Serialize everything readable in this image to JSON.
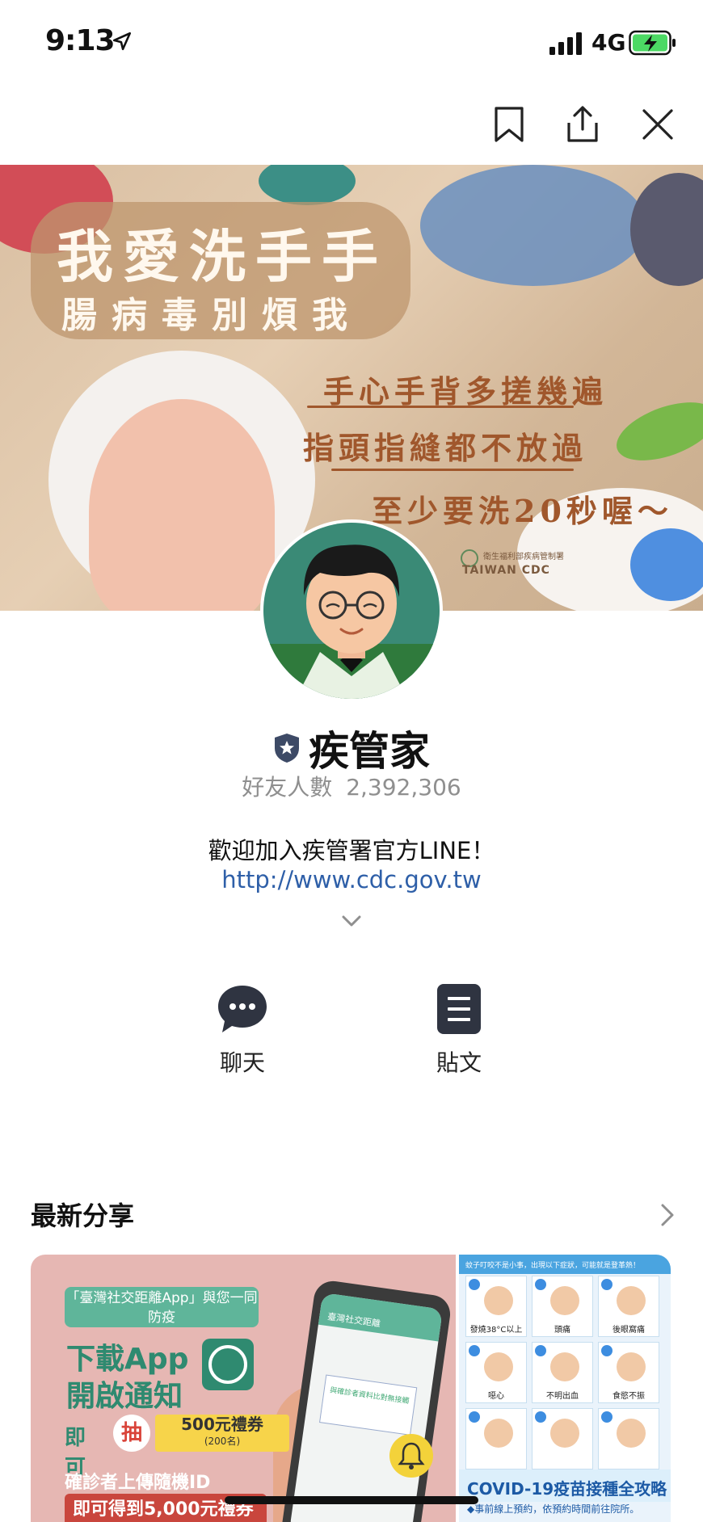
{
  "status_bar": {
    "time": "9:13",
    "network": "4G",
    "icons": [
      "location-arrow-icon",
      "signal-bars-icon",
      "battery-charging-icon"
    ],
    "battery_color": "#4cd964"
  },
  "toolbar": {
    "icons": [
      "bookmark-icon",
      "share-icon",
      "close-icon"
    ]
  },
  "cover": {
    "title": "我愛洗手手",
    "subtitle": "腸病毒別煩我",
    "line1": "手心手背多搓幾遍",
    "line2": "指頭指縫都不放過",
    "line3": "至少要洗20秒喔～",
    "org_name": "TAIWAN CDC",
    "org_sub": "衛生福利部疾病管制署"
  },
  "profile": {
    "name": "疾管家",
    "friends_label": "好友人數",
    "friends_count": "2,392,306",
    "description": "歡迎加入疾管署官方LINE！",
    "link": "http://www.cdc.gov.tw"
  },
  "actions": {
    "chat_label": "聊天",
    "posts_label": "貼文"
  },
  "latest": {
    "title": "最新分享",
    "card_main": {
      "banner": "「臺灣社交距離App」與您一同防疫",
      "big1": "下載App",
      "big2": "開啟通知",
      "draw_prefix": "即可",
      "draw": "抽",
      "prize": "500元禮券",
      "prize_count": "(200名)",
      "upload": "確診者上傳隨機ID",
      "get": "即可得到5,000元禮券",
      "phone_title": "臺灣社交距離",
      "phone_box": "與確診者資料比對無接觸"
    },
    "card_side": {
      "top": "蚊子叮咬不是小事，出現以下症狀，可能就是登革熱！",
      "symptoms": [
        "發燒38°C以上",
        "頭痛",
        "後眼窩痛",
        "噁心",
        "不明出血",
        "食慾不振",
        "",
        "",
        ""
      ],
      "covid_title": "COVID-19疫苗接種全攻略",
      "covid_sub": "◆事前線上預約，依預約時間前往院所。"
    }
  },
  "colors": {
    "accent_link": "#2e5fa8",
    "muted_text": "#8f8f8f",
    "avatar_bg": "#3a8a76"
  }
}
